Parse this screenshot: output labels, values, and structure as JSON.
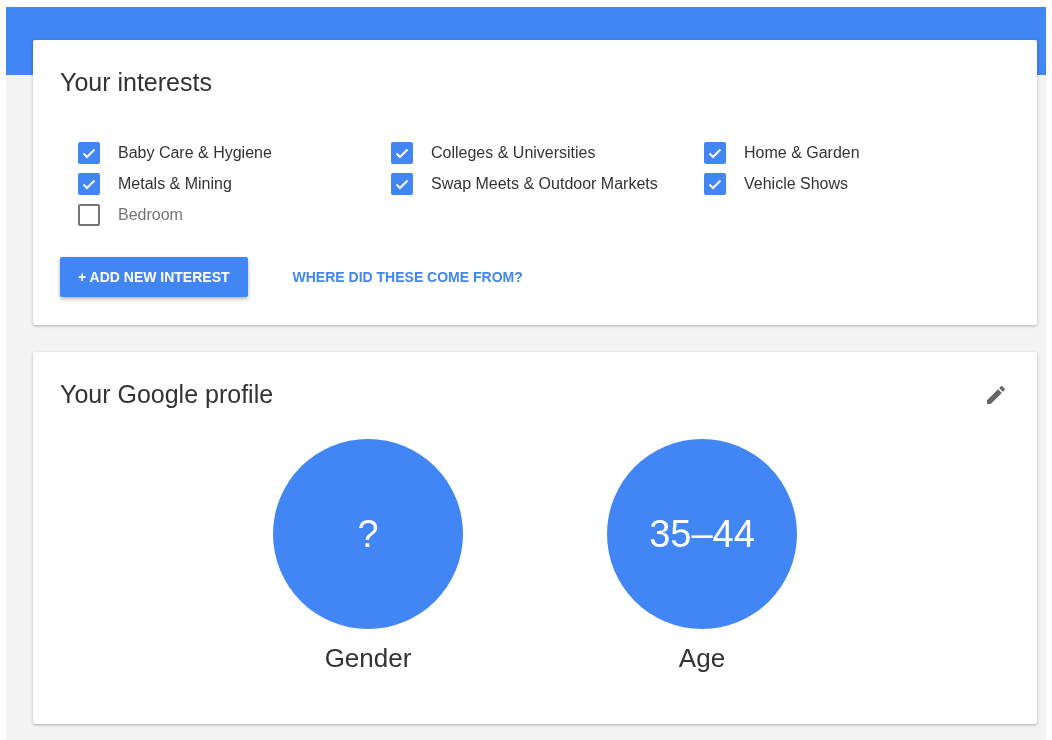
{
  "interests": {
    "title": "Your interests",
    "items": [
      {
        "label": "Baby Care & Hygiene",
        "checked": true
      },
      {
        "label": "Colleges & Universities",
        "checked": true
      },
      {
        "label": "Home & Garden",
        "checked": true
      },
      {
        "label": "Metals & Mining",
        "checked": true
      },
      {
        "label": "Swap Meets & Outdoor Markets",
        "checked": true
      },
      {
        "label": "Vehicle Shows",
        "checked": true
      },
      {
        "label": "Bedroom",
        "checked": false
      }
    ],
    "add_button": "+ ADD NEW INTEREST",
    "link": "WHERE DID THESE COME FROM?"
  },
  "profile": {
    "title": "Your Google profile",
    "stats": [
      {
        "value": "?",
        "label": "Gender"
      },
      {
        "value": "35–44",
        "label": "Age"
      }
    ]
  }
}
